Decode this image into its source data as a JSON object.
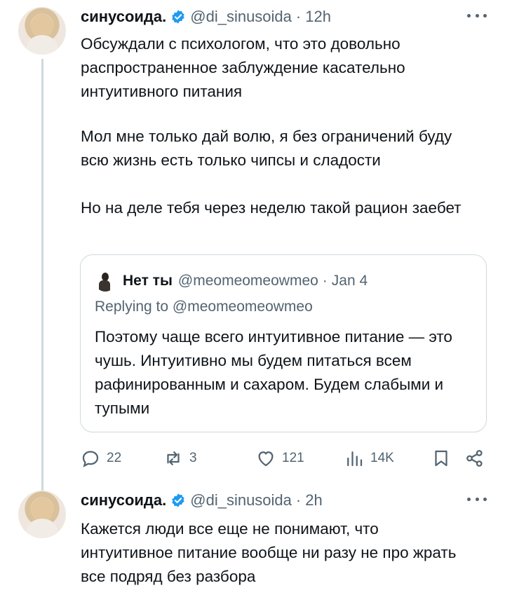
{
  "tweets": [
    {
      "author_name": "синусоида.",
      "handle": "@di_sinusoida",
      "separator": "·",
      "time": "12h",
      "paragraphs": [
        "Обсуждали с психологом, что это довольно распространенное заблуждение касательно интуитивного питания",
        "Мол мне только дай волю, я без ограничений буду всю жизнь есть только чипсы и сладости",
        "Но на деле тебя через неделю такой рацион заебет"
      ],
      "quote": {
        "author_name": "Нет ты",
        "handle": "@meomeomeowmeo",
        "separator": "·",
        "date": "Jan 4",
        "replying_to": "Replying to @meomeomeowmeo",
        "text": "Поэтому чаще всего интуитивное питание — это чушь. Интуитивно мы будем питаться всем рафинированным и сахаром. Будем слабыми и тупыми"
      },
      "actions": {
        "replies": "22",
        "retweets": "3",
        "likes": "121",
        "views": "14K"
      }
    },
    {
      "author_name": "синусоида.",
      "handle": "@di_sinusoida",
      "separator": "·",
      "time": "2h",
      "text": "Кажется люди все еще не понимают, что интуитивное питание вообще ни разу не про жрать все подряд без разбора"
    }
  ],
  "icons": {
    "verified": "verified-badge-icon",
    "more": "more-icon",
    "reply": "reply-icon",
    "retweet": "retweet-icon",
    "like": "heart-icon",
    "views": "views-icon",
    "bookmark": "bookmark-icon",
    "share": "share-icon"
  },
  "colors": {
    "verified": "#1d9bf0",
    "secondary_text": "#536471",
    "border": "#cfd9de"
  }
}
